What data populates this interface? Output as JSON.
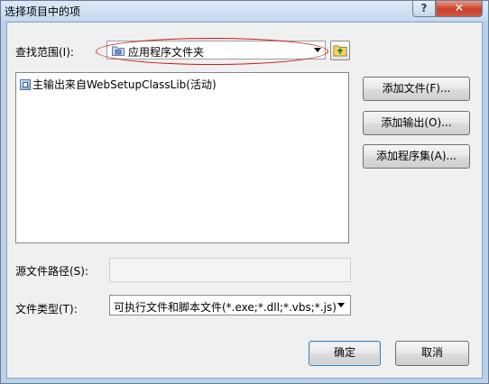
{
  "window": {
    "title": "选择项目中的项",
    "help_glyph": "?",
    "close_glyph": "✕"
  },
  "lookin": {
    "label": "查找范围(I):",
    "value": "应用程序文件夹"
  },
  "list": {
    "items": [
      {
        "label": "主输出来自WebSetupClassLib(活动)"
      }
    ]
  },
  "buttons": {
    "add_file": "添加文件(F)...",
    "add_output": "添加输出(O)...",
    "add_assembly": "添加程序集(A)...",
    "ok": "确定",
    "cancel": "取消"
  },
  "source_path": {
    "label": "源文件路径(S):",
    "value": ""
  },
  "file_type": {
    "label": "文件类型(T):",
    "value": "可执行文件和脚本文件(*.exe;*.dll;*.vbs;*.js)"
  },
  "colors": {
    "annotation_ellipse": "#cc1a1a",
    "close_button": "#c7402a"
  }
}
